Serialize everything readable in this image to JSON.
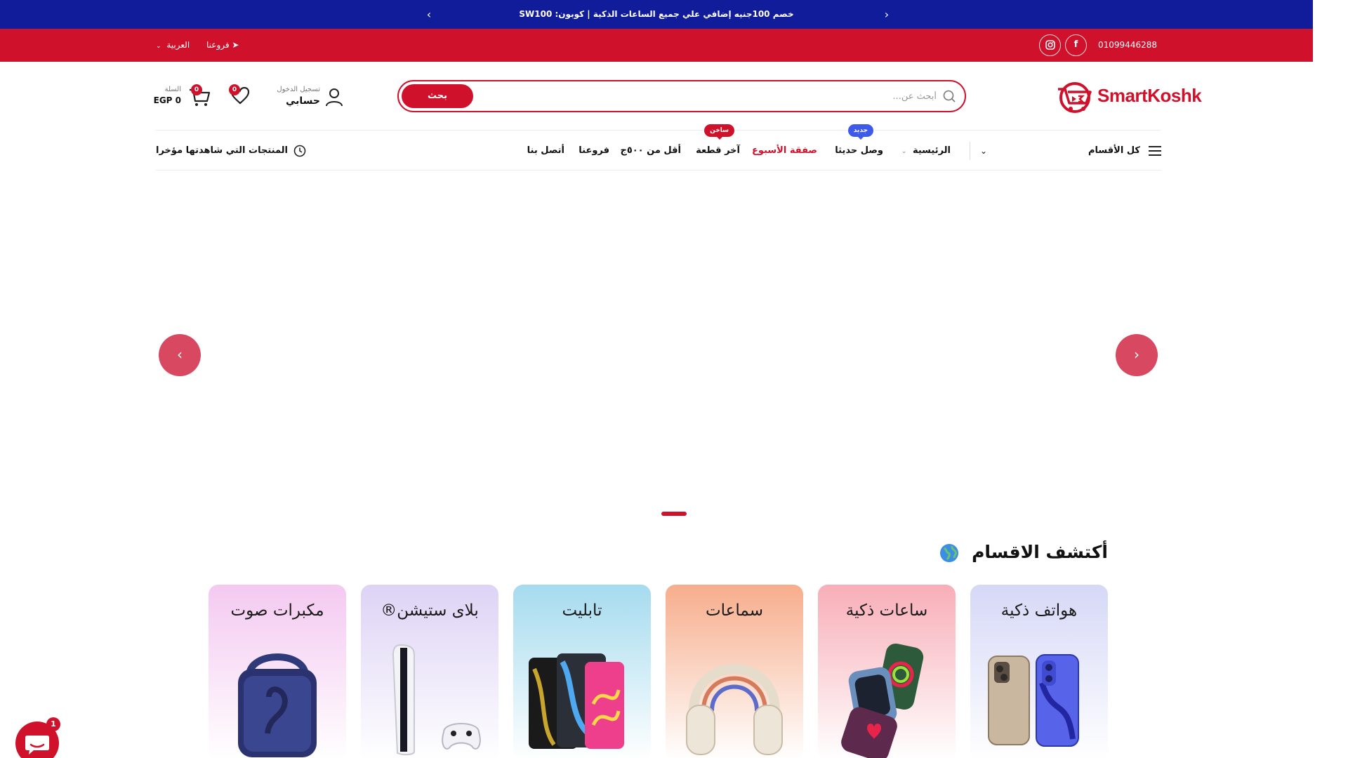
{
  "announcement": {
    "text": "خصم 100جنيه إضافي علي جميع الساعات الذكية | كوبون: SW100",
    "prev_icon": "chevron-left-icon",
    "next_icon": "chevron-right-icon"
  },
  "topbar": {
    "phone": "01099446288",
    "socials": [
      "facebook-icon",
      "instagram-icon"
    ],
    "branches_link": "➤ فروعنا",
    "language": "العربية"
  },
  "header": {
    "logo_text": "SmartKoshk",
    "search": {
      "placeholder": "أبحث عن...",
      "button": "بحث"
    },
    "account": {
      "sub": "تسجيل الدخول",
      "main": "حسابي"
    },
    "wishlist_count": "0",
    "cart": {
      "sub": "السلة",
      "total": "EGP 0",
      "count": "0"
    }
  },
  "nav": {
    "all_categories": "كل الأقسام",
    "items": [
      {
        "label": "الرئيسية"
      },
      {
        "label": "وصل حديثا",
        "tag": "جديد",
        "tag_color": "#3d5be8"
      },
      {
        "label": "صفقة الأسبوع",
        "highlight": true
      },
      {
        "label": "آخر قطعة",
        "tag": "ساخن",
        "tag_color": "#d0112b"
      },
      {
        "label": "أقل من ٥٠٠ج"
      },
      {
        "label": "فروعنا"
      },
      {
        "label": "أتصل بنا"
      }
    ],
    "recently_viewed": "المنتجات التي شاهدتها مؤخرا"
  },
  "hero": {
    "prev_icon": "chevron-left-icon",
    "next_icon": "chevron-right-icon",
    "active_slide": 1
  },
  "categories": {
    "title": "أكتشف الاقسام",
    "items": [
      {
        "label": "هواتف ذكية",
        "color_top": "#d6d8f7"
      },
      {
        "label": "ساعات ذكية",
        "color_top": "#f8aeb8"
      },
      {
        "label": "سماعات",
        "color_top": "#f7ad8c"
      },
      {
        "label": "تابليت",
        "color_top": "#a5dbef"
      },
      {
        "label": "بلاى ستيشن®",
        "color_top": "#ddd3f5"
      },
      {
        "label": "مكبرات صوت",
        "color_top": "#f4c9f1"
      }
    ]
  },
  "chat": {
    "badge": "1",
    "icon": "chat-bubble-icon"
  },
  "colors": {
    "brand_red": "#d0112b",
    "announce_blue": "#101c99"
  }
}
